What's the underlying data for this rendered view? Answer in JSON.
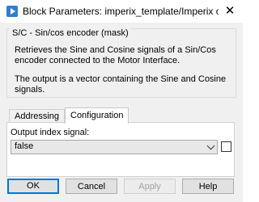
{
  "window": {
    "title": "Block Parameters: imperix_template/Imperix contr…",
    "close_glyph": "✕"
  },
  "mask": {
    "title": "S/C - Sin/cos encoder (mask)",
    "description": "Retrieves the Sine and Cosine signals of a Sin/Cos encoder connected to the Motor Interface.",
    "note": "The output is a vector containing the Sine and Cosine signals."
  },
  "tabs": [
    {
      "label": "Addressing",
      "active": false
    },
    {
      "label": "Configuration",
      "active": true
    }
  ],
  "configuration": {
    "output_index_label": "Output index signal:",
    "output_index_value": "false",
    "checkbox_checked": false
  },
  "buttons": {
    "ok": "OK",
    "cancel": "Cancel",
    "apply": "Apply",
    "help": "Help"
  },
  "colors": {
    "accent": "#0078d7",
    "dialog_bg": "#f0f0f0"
  }
}
